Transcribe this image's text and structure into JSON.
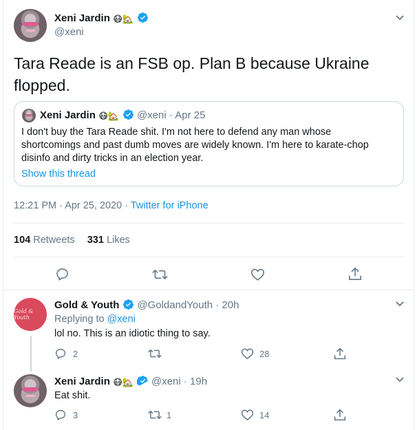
{
  "tweet": {
    "author_name": "Xeni Jardin",
    "author_emoji_1": "😷",
    "author_emoji_2": "🏡",
    "author_handle": "@xeni",
    "text_line1": "Tara Reade is an FSB op. Plan B because Ukraine",
    "text_line2": "flopped.",
    "timestamp": "12:21 PM · Apr 25, 2020 · ",
    "source": "Twitter for iPhone",
    "retweets_count": "104",
    "retweets_label": "Retweets",
    "likes_count": "331",
    "likes_label": "Likes"
  },
  "quoted": {
    "author_name": "Xeni Jardin",
    "author_emoji_1": "😷",
    "author_emoji_2": "🏡",
    "handle_date": "@xeni · Apr 25",
    "line1": "I don't buy the Tara Reade shit. I'm not here to defend any man whose",
    "line2": "shortcomings and past dumb moves are widely known. I'm here to karate-chop",
    "line3": "disinfo and dirty tricks in an election year.",
    "show_thread": "Show this thread"
  },
  "replies": [
    {
      "author_name": "Gold & Youth",
      "avatar_text": "Gold & Youth",
      "handle_time": "@GoldandYouth · 20h",
      "replying_prefix": "Replying to ",
      "replying_handle": "@xeni",
      "text": "lol no. This is an idiotic thing to say.",
      "replies_count": "2",
      "retweets_count": "",
      "likes_count": "28"
    },
    {
      "author_name": "Xeni Jardin",
      "author_emoji_1": "😷",
      "author_emoji_2": "🏡",
      "handle_time": "@xeni · 19h",
      "text": "Eat shit.",
      "replies_count": "3",
      "retweets_count": "1",
      "likes_count": "14"
    }
  ],
  "colors": {
    "accent": "#1da1f2",
    "link": "#1b95e0",
    "muted": "#657786",
    "border": "#e6ecf0"
  },
  "icons": [
    "chevron-down-icon",
    "verified-badge-icon",
    "reply-icon",
    "retweet-icon",
    "like-icon",
    "share-icon"
  ]
}
